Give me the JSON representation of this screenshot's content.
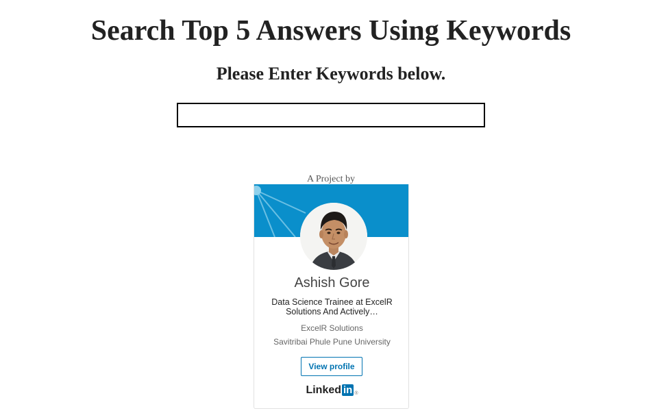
{
  "page": {
    "title": "Search Top 5 Answers Using Keywords",
    "subtitle": "Please Enter Keywords below."
  },
  "search": {
    "value": "",
    "placeholder": ""
  },
  "credit": {
    "label": "A Project by"
  },
  "badge": {
    "name": "Ashish Gore",
    "headline": "Data Science Trainee at ExcelR Solutions And Actively…",
    "company": "ExcelR Solutions",
    "school": "Savitribai Phule Pune University",
    "view_profile_label": "View profile",
    "logo_text": "Linked",
    "logo_box_text": "in",
    "logo_reg": "®",
    "banner_color": "#0a8fcb",
    "button_color": "#0073b1"
  }
}
